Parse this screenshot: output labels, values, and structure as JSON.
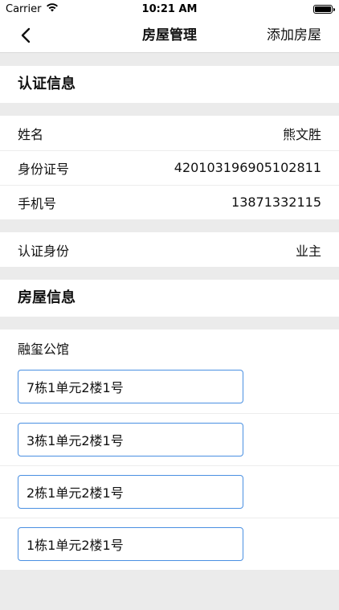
{
  "status_bar": {
    "carrier": "Carrier",
    "time": "10:21 AM",
    "battery_level": 1.0
  },
  "nav": {
    "title": "房屋管理",
    "right_action": "添加房屋"
  },
  "auth_section": {
    "title": "认证信息",
    "rows": [
      {
        "label": "姓名",
        "value": "熊文胜"
      },
      {
        "label": "身份证号",
        "value": "420103196905102811"
      },
      {
        "label": "手机号",
        "value": "13871332115"
      }
    ],
    "identity": {
      "label": "认证身份",
      "value": "业主"
    }
  },
  "house_section": {
    "title": "房屋信息",
    "community": "融玺公馆",
    "units": [
      "7栋1单元2楼1号",
      "3栋1单元2楼1号",
      "2栋1单元2楼1号",
      "1栋1单元2楼1号"
    ]
  },
  "colors": {
    "background": "#ebebeb",
    "accent_border": "#4a90e2"
  }
}
